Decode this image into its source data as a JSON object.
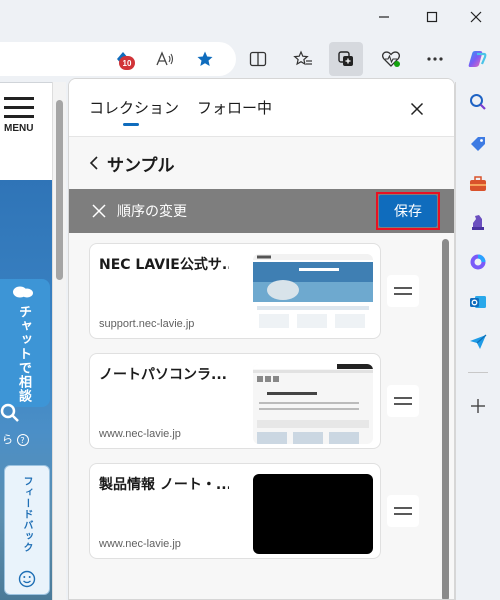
{
  "window": {
    "minimize_icon": "minimize-icon",
    "maximize_icon": "maximize-icon",
    "close_icon": "close-icon"
  },
  "toolbar": {
    "tracker_badge": "10",
    "icons": [
      "tracking-prevention-icon",
      "read-aloud-icon",
      "favorite-star-icon",
      "split-screen-icon",
      "favorites-icon",
      "collections-icon",
      "browser-essentials-icon",
      "more-icon",
      "copilot-icon"
    ]
  },
  "webpage": {
    "menu_label": "MENU",
    "chat_label": "チャットで相談",
    "feedback_label": "フィードバック",
    "partial_text": "ら"
  },
  "collections_panel": {
    "tabs": [
      {
        "label": "コレクション",
        "active": true
      },
      {
        "label": "フォロー中",
        "active": false
      }
    ],
    "collection_title": "サンプル",
    "reorder_label": "順序の変更",
    "save_label": "保存",
    "items": [
      {
        "title": "NEC LAVIE公式サ...",
        "url": "support.nec-lavie.jp",
        "thumbnail": "site-screenshot"
      },
      {
        "title": "ノートパソコンラ...",
        "url": "www.nec-lavie.jp",
        "thumbnail": "site-screenshot"
      },
      {
        "title": "製品情報 ノート・...",
        "url": "www.nec-lavie.jp",
        "thumbnail": "black"
      }
    ]
  },
  "sidebar": {
    "icons": [
      "search-icon",
      "shopping-tag-icon",
      "tools-icon",
      "games-icon",
      "microsoft365-icon",
      "outlook-icon",
      "drop-icon",
      "add-icon"
    ]
  },
  "colors": {
    "accent": "#0f6cbd",
    "highlight_outline": "#e81123",
    "reorder_bar": "#7e7e7e"
  }
}
